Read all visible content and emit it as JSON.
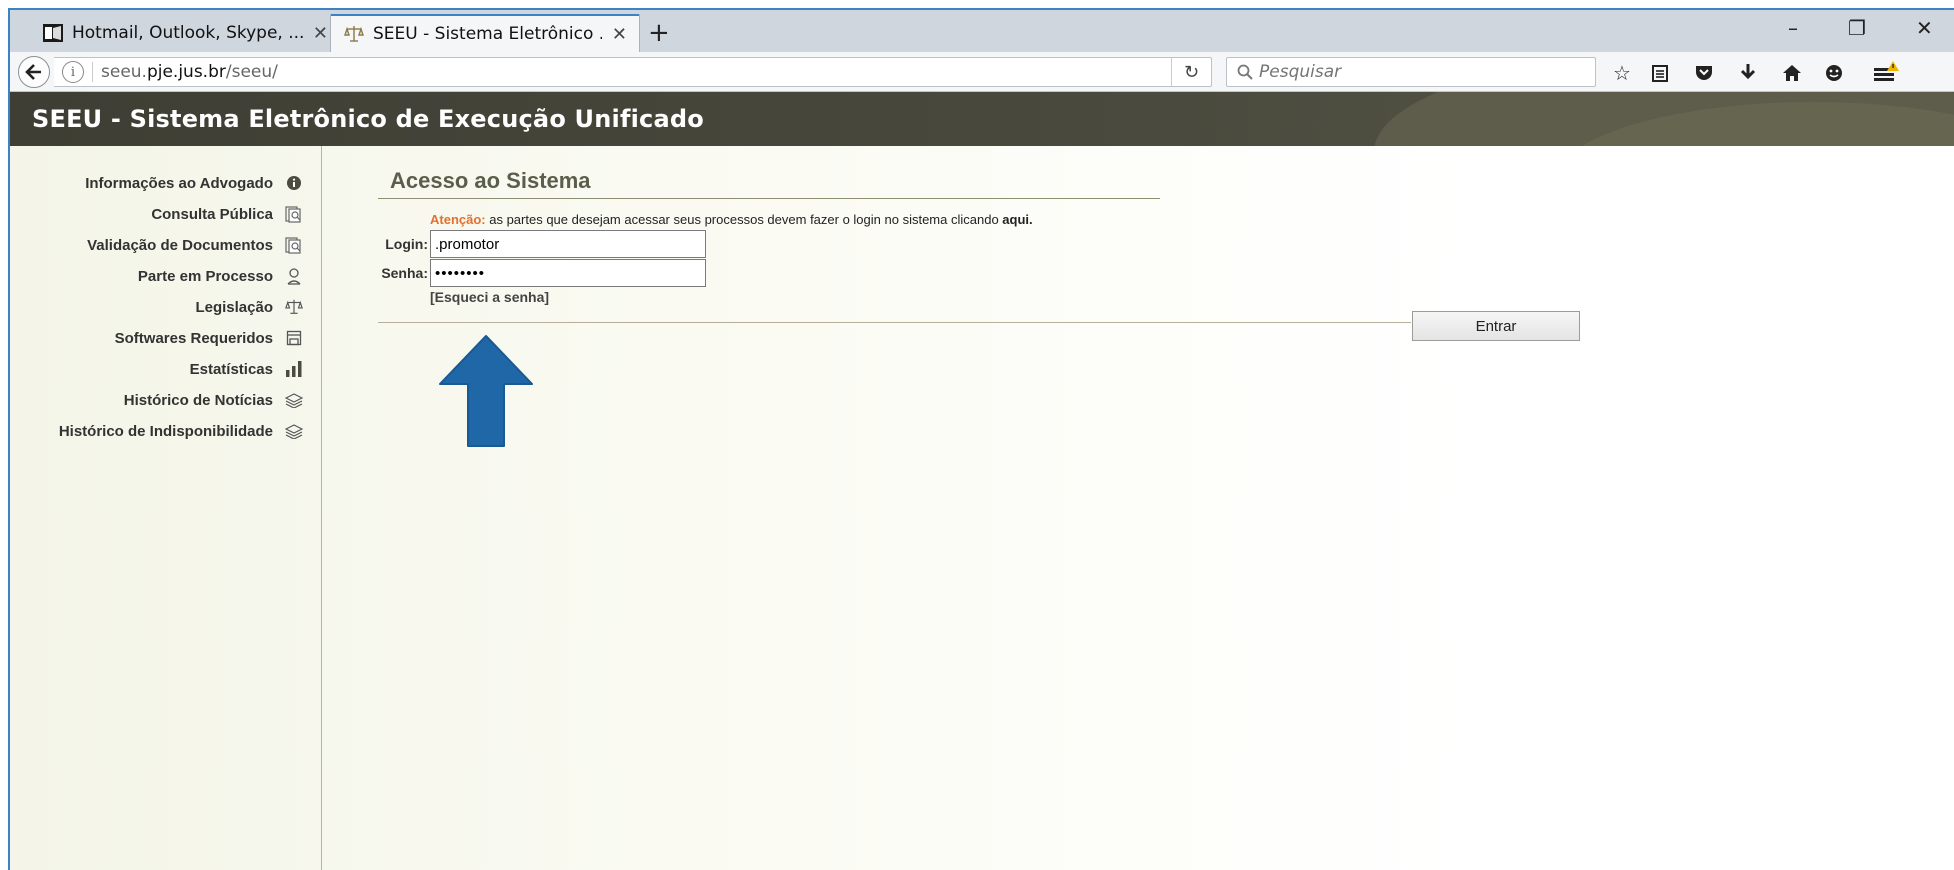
{
  "browser": {
    "tabs": [
      {
        "title": "Hotmail, Outlook, Skype, ...",
        "active": false
      },
      {
        "title": "SEEU - Sistema Eletrônico ...",
        "active": true
      }
    ],
    "new_tab_label": "+",
    "url_prefix": "seeu.",
    "url_domain": "pje.jus.br",
    "url_path": "/seeu/",
    "search_placeholder": "Pesquisar",
    "window_controls": {
      "minimize": "–",
      "maximize": "❐",
      "close": "✕"
    }
  },
  "app": {
    "title": "SEEU - Sistema Eletrônico de Execução Unificado"
  },
  "sidebar": {
    "items": [
      {
        "label": "Informações ao Advogado",
        "icon": "info-icon"
      },
      {
        "label": "Consulta Pública",
        "icon": "document-search-icon"
      },
      {
        "label": "Validação de Documentos",
        "icon": "document-search-icon"
      },
      {
        "label": "Parte em Processo",
        "icon": "person-icon"
      },
      {
        "label": "Legislação",
        "icon": "scales-icon"
      },
      {
        "label": "Softwares Requeridos",
        "icon": "floppy-disk-icon"
      },
      {
        "label": "Estatísticas",
        "icon": "bar-chart-icon"
      },
      {
        "label": "Histórico de Notícias",
        "icon": "stack-icon"
      },
      {
        "label": "Histórico de Indisponibilidade",
        "icon": "stack-icon"
      }
    ]
  },
  "login": {
    "heading": "Acesso ao Sistema",
    "notice_warn": "Atenção:",
    "notice_text": " as partes que desejam acessar seus processos devem fazer o login no sistema clicando ",
    "notice_link": "aqui.",
    "login_label": "Login:",
    "login_value": ".promotor",
    "password_label": "Senha:",
    "password_value": "********",
    "forgot_label": "[Esqueci a senha]",
    "submit_label": "Entrar"
  },
  "colors": {
    "header_bg": "#4a4a3e",
    "heading": "#5a5e4a",
    "warn": "#e2702e",
    "arrow": "#1f67a6"
  }
}
